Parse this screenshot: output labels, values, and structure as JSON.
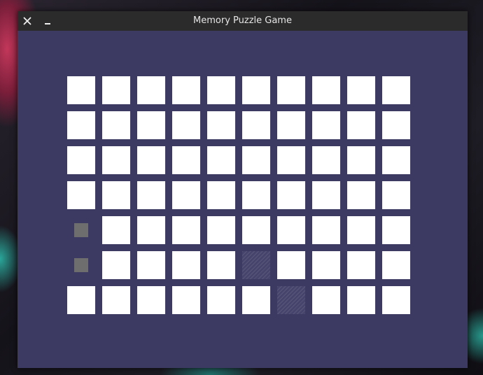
{
  "window": {
    "title": "Memory Puzzle Game"
  },
  "titlebar": {
    "close_icon": "close-icon",
    "minimize_icon": "minimize-icon"
  },
  "colors": {
    "board_background": "#3c3a62",
    "hidden_tile": "#ffffff",
    "matched_marker": "#6e6e6e",
    "titlebar": "#2b2b2b"
  },
  "board": {
    "rows": 7,
    "columns": 10,
    "tiles": [
      [
        "hidden",
        "hidden",
        "hidden",
        "hidden",
        "hidden",
        "hidden",
        "hidden",
        "hidden",
        "hidden",
        "hidden"
      ],
      [
        "hidden",
        "hidden",
        "hidden",
        "hidden",
        "hidden",
        "hidden",
        "hidden",
        "hidden",
        "hidden",
        "hidden"
      ],
      [
        "hidden",
        "hidden",
        "hidden",
        "hidden",
        "hidden",
        "hidden",
        "hidden",
        "hidden",
        "hidden",
        "hidden"
      ],
      [
        "hidden",
        "hidden",
        "hidden",
        "hidden",
        "hidden",
        "hidden",
        "hidden",
        "hidden",
        "hidden",
        "hidden"
      ],
      [
        "matched",
        "hidden",
        "hidden",
        "hidden",
        "hidden",
        "hidden",
        "hidden",
        "hidden",
        "hidden",
        "hidden"
      ],
      [
        "matched",
        "hidden",
        "hidden",
        "hidden",
        "hidden",
        "revealed",
        "hidden",
        "hidden",
        "hidden",
        "hidden"
      ],
      [
        "hidden",
        "hidden",
        "hidden",
        "hidden",
        "hidden",
        "hidden",
        "revealed",
        "hidden",
        "hidden",
        "hidden"
      ]
    ]
  }
}
